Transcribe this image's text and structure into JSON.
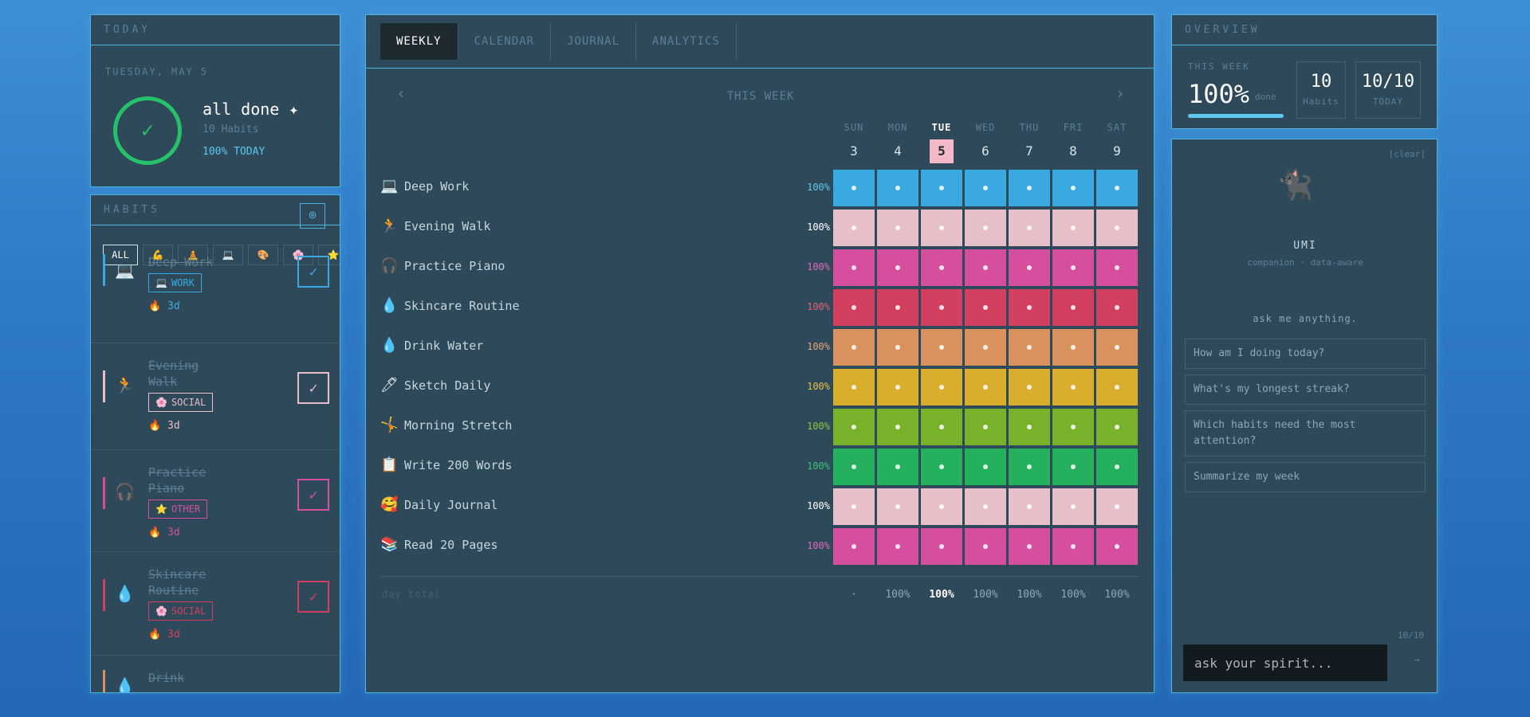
{
  "today": {
    "header": "TODAY",
    "date": "TUESDAY, MAY 5",
    "check_glyph": "✓",
    "status": "all done ✦",
    "habit_count": "10 Habits",
    "percent_today": "100% TODAY"
  },
  "habits_panel": {
    "header": "HABITS",
    "camera_icon": "⌾",
    "filters": [
      {
        "label": "ALL"
      },
      {
        "label": "💪"
      },
      {
        "label": "🧘"
      },
      {
        "label": "💻"
      },
      {
        "label": "🎨"
      },
      {
        "label": "🌸"
      },
      {
        "label": "⭐"
      }
    ],
    "cards": [
      {
        "name": "Deep Work",
        "icon": "💻",
        "tag": "WORK",
        "tag_icon": "💻",
        "streak": "🔥 3d",
        "check": "✓",
        "color": "#3aa9e0"
      },
      {
        "name": "Evening Walk",
        "icon": "🏃",
        "tag": "SOCIAL",
        "tag_icon": "🌸",
        "streak": "🔥 3d",
        "check": "✓",
        "color": "#e6bfc8"
      },
      {
        "name": "Practice Piano",
        "icon": "🎧",
        "tag": "OTHER",
        "tag_icon": "⭐",
        "streak": "🔥 3d",
        "check": "✓",
        "color": "#d64f9e"
      },
      {
        "name": "Skincare Routine",
        "icon": "💧",
        "tag": "SOCIAL",
        "tag_icon": "🌸",
        "streak": "🔥 3d",
        "check": "✓",
        "color": "#d33f5f"
      },
      {
        "name": "Drink",
        "icon": "💧",
        "tag": "",
        "tag_icon": "",
        "streak": "",
        "check": "",
        "color": "#d9925e"
      }
    ]
  },
  "tabs": [
    {
      "label": "WEEKLY"
    },
    {
      "label": "CALENDAR"
    },
    {
      "label": "JOURNAL"
    },
    {
      "label": "ANALYTICS"
    }
  ],
  "week": {
    "prev": "‹",
    "title": "THIS WEEK",
    "next": "›",
    "days": [
      {
        "name": "SUN",
        "num": "3"
      },
      {
        "name": "MON",
        "num": "4"
      },
      {
        "name": "TUE",
        "num": "5"
      },
      {
        "name": "WED",
        "num": "6"
      },
      {
        "name": "THU",
        "num": "7"
      },
      {
        "name": "FRI",
        "num": "8"
      },
      {
        "name": "SAT",
        "num": "9"
      }
    ],
    "rows": [
      {
        "icon": "💻",
        "name": "Deep Work",
        "pct": "100%",
        "color": "#3aa9e0",
        "pct_color": "#5ec6f0"
      },
      {
        "icon": "🏃",
        "name": "Evening Walk",
        "pct": "100%",
        "color": "#e6bfc8",
        "pct_color": "#ffffff"
      },
      {
        "icon": "🎧",
        "name": "Practice Piano",
        "pct": "100%",
        "color": "#d64f9e",
        "pct_color": "#e06bb0"
      },
      {
        "icon": "💧",
        "name": "Skincare Routine",
        "pct": "100%",
        "color": "#d33f5f",
        "pct_color": "#e0607a"
      },
      {
        "icon": "💧",
        "name": "Drink Water",
        "pct": "100%",
        "color": "#d9925e",
        "pct_color": "#e6a679"
      },
      {
        "icon": "🖊",
        "name": "Sketch Daily",
        "pct": "100%",
        "color": "#d9ae2c",
        "pct_color": "#e6c24a"
      },
      {
        "icon": "🤸",
        "name": "Morning Stretch",
        "pct": "100%",
        "color": "#78b12a",
        "pct_color": "#8fc440"
      },
      {
        "icon": "📋",
        "name": "Write 200 Words",
        "pct": "100%",
        "color": "#25b05e",
        "pct_color": "#38c272"
      },
      {
        "icon": "🥰",
        "name": "Daily Journal",
        "pct": "100%",
        "color": "#e6bfc8",
        "pct_color": "#ffffff"
      },
      {
        "icon": "📚",
        "name": "Read 20 Pages",
        "pct": "100%",
        "color": "#d64f9e",
        "pct_color": "#e06bb0"
      }
    ],
    "total_label": "day total",
    "totals": [
      "·",
      "100%",
      "100%",
      "100%",
      "100%",
      "100%",
      "100%"
    ]
  },
  "overview": {
    "header": "OVERVIEW",
    "this_week_label": "THIS WEEK",
    "pct": "100%",
    "done_label": "done",
    "habits_value": "10",
    "habits_label": "Habits",
    "today_value": "10/10",
    "today_label": "TODAY",
    "progress": 1.0
  },
  "spirit": {
    "clear": "[clear]",
    "avatar": "🐈‍⬛",
    "name": "UMI",
    "subtitle": "companion · data-aware",
    "hint": "ask me anything.",
    "suggestions": [
      "How am I doing today?",
      "What's my longest streak?",
      "Which habits need the most attention?",
      "Summarize my week"
    ],
    "counter": "10/10",
    "input_placeholder": "ask your spirit...",
    "send": "→"
  }
}
